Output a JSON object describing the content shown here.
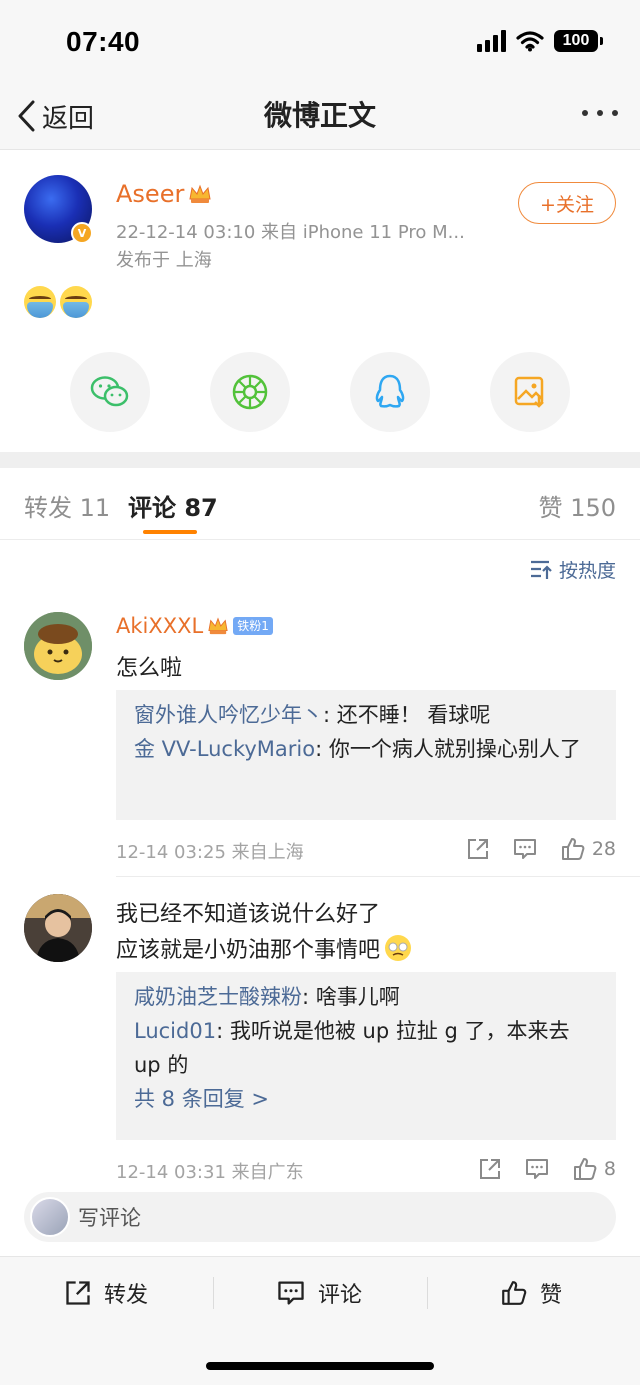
{
  "status_bar": {
    "time": "07:40",
    "battery": "100"
  },
  "nav": {
    "back_label": "返回",
    "title": "微博正文"
  },
  "post": {
    "author": "Aseer",
    "meta": "22-12-14 03:10  来自 iPhone 11 Pro M...",
    "location": "发布于 上海",
    "follow_label": "+关注",
    "share_targets": [
      "wechat",
      "moments",
      "qq",
      "save-image"
    ]
  },
  "tabs": [
    {
      "label": "转发",
      "count": "11"
    },
    {
      "label": "评论",
      "count": "87"
    },
    {
      "label": "赞",
      "count": "150"
    }
  ],
  "sort_label": "按热度",
  "comments": [
    {
      "user": "AkiXXXL",
      "fan_badge": "铁粉1",
      "text": "怎么啦",
      "replies": [
        {
          "user": "窗外谁人吟忆少年丶",
          "text": ": 还不睡！ 看球呢"
        },
        {
          "user": "金 VV-LuckyMario",
          "text": ": 你一个病人就别操心别人了"
        }
      ],
      "time": "12-14 03:25",
      "source": "来自上海",
      "likes": "28"
    },
    {
      "user": "",
      "text_line1": "我已经不知道该说什么好了",
      "text_line2": "应该就是小奶油那个事情吧",
      "replies": [
        {
          "user": "咸奶油芝士酸辣粉",
          "text": ": 啥事儿啊"
        },
        {
          "user": "Lucid01",
          "text": ": 我听说是他被 up 拉扯 g 了，本来去 up 的"
        }
      ],
      "more_replies": "共 8 条回复 >",
      "time": "12-14 03:31",
      "source": "来自广东",
      "likes": "8"
    }
  ],
  "write_comment_placeholder": "写评论",
  "bottom_actions": {
    "repost": "转发",
    "comment": "评论",
    "like": "赞"
  },
  "colors": {
    "accent": "#ff8200",
    "username": "#e8702a",
    "link": "#4c6a96"
  }
}
